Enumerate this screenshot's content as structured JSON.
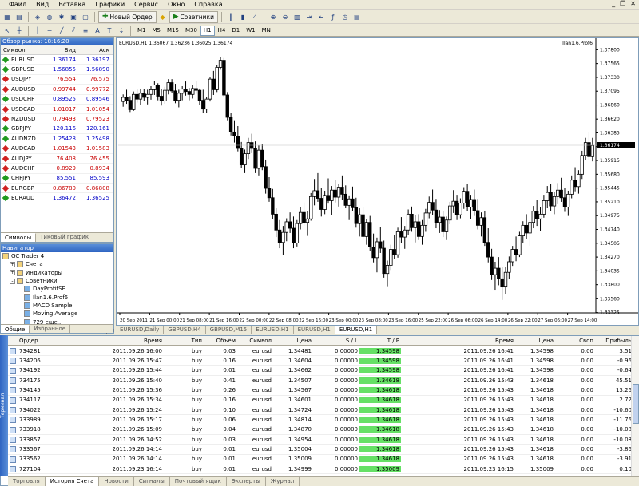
{
  "menu": [
    "Файл",
    "Вид",
    "Вставка",
    "Графики",
    "Сервис",
    "Окно",
    "Справка"
  ],
  "toolbar": {
    "new_order": "Новый Ордер",
    "advisors": "Советники",
    "timeframes": [
      "M1",
      "M5",
      "M15",
      "M30",
      "H1",
      "H4",
      "D1",
      "W1",
      "MN"
    ],
    "active_tf": "H1"
  },
  "market_watch": {
    "title": "Обзор рынка: 18:16:20",
    "col_symbol": "Символ",
    "col_bid": "Вид",
    "col_ask": "Аск",
    "rows": [
      {
        "s": "EURUSD",
        "b": "1.36174",
        "a": "1.36197",
        "d": "up"
      },
      {
        "s": "GBPUSD",
        "b": "1.56855",
        "a": "1.56890",
        "d": "up"
      },
      {
        "s": "USDJPY",
        "b": "76.554",
        "a": "76.575",
        "d": "dn"
      },
      {
        "s": "AUDUSD",
        "b": "0.99744",
        "a": "0.99772",
        "d": "dn"
      },
      {
        "s": "USDCHF",
        "b": "0.89525",
        "a": "0.89546",
        "d": "up"
      },
      {
        "s": "USDCAD",
        "b": "1.01017",
        "a": "1.01054",
        "d": "dn"
      },
      {
        "s": "NZDUSD",
        "b": "0.79493",
        "a": "0.79523",
        "d": "dn"
      },
      {
        "s": "GBPJPY",
        "b": "120.116",
        "a": "120.161",
        "d": "up"
      },
      {
        "s": "AUDNZD",
        "b": "1.25428",
        "a": "1.25498",
        "d": "up"
      },
      {
        "s": "AUDCAD",
        "b": "1.01543",
        "a": "1.01583",
        "d": "dn"
      },
      {
        "s": "AUDJPY",
        "b": "76.408",
        "a": "76.455",
        "d": "dn"
      },
      {
        "s": "AUDCHF",
        "b": "0.8929",
        "a": "0.8934",
        "d": "dn"
      },
      {
        "s": "CHFJPY",
        "b": "85.551",
        "a": "85.593",
        "d": "up"
      },
      {
        "s": "EURGBP",
        "b": "0.86780",
        "a": "0.86808",
        "d": "dn"
      },
      {
        "s": "EURAUD",
        "b": "1.36472",
        "a": "1.36525",
        "d": "up"
      }
    ],
    "tabs": [
      "Символы",
      "Тиковый график"
    ]
  },
  "navigator": {
    "title": "Навигатор",
    "items": [
      {
        "t": "GC Trader 4",
        "lvl": 0,
        "pm": ""
      },
      {
        "t": "Счета",
        "lvl": 1,
        "pm": "+"
      },
      {
        "t": "Индикаторы",
        "lvl": 1,
        "pm": "+"
      },
      {
        "t": "Советники",
        "lvl": 1,
        "pm": "-"
      },
      {
        "t": "DayProfitSE",
        "lvl": 2,
        "pm": ""
      },
      {
        "t": "Ilan1.6.Prof6",
        "lvl": 2,
        "pm": ""
      },
      {
        "t": "MACD Sample",
        "lvl": 2,
        "pm": ""
      },
      {
        "t": "Moving Average",
        "lvl": 2,
        "pm": ""
      },
      {
        "t": "729 еще...",
        "lvl": 2,
        "pm": ""
      },
      {
        "t": "Пользовательские Индикаторы",
        "lvl": 1,
        "pm": "+"
      }
    ],
    "tabs": [
      "Общие",
      "Избранное"
    ]
  },
  "chart": {
    "header": "EURUSD,H1  1.36067 1.36236 1.36025 1.36174",
    "ea_label": "Ilan1.6.Prof6",
    "current_price": "1.36174",
    "price_labels": [
      "1.37800",
      "1.37565",
      "1.37330",
      "1.37095",
      "1.36860",
      "1.36620",
      "1.36385",
      "1.36150",
      "1.35915",
      "1.35680",
      "1.35445",
      "1.35210",
      "1.34975",
      "1.34740",
      "1.34505",
      "1.34270",
      "1.34035",
      "1.33800",
      "1.33560",
      "1.33325"
    ],
    "time_labels": [
      "20 Sep 2011",
      "21 Sep 00:00",
      "21 Sep 08:00",
      "21 Sep 16:00",
      "22 Sep 00:00",
      "22 Sep 08:00",
      "22 Sep 16:00",
      "23 Sep 00:00",
      "23 Sep 08:00",
      "23 Sep 16:00",
      "25 Sep 22:00",
      "26 Sep 06:00",
      "26 Sep 14:00",
      "26 Sep 22:00",
      "27 Sep 06:00",
      "27 Sep 14:00"
    ]
  },
  "chart_data": {
    "type": "candlestick",
    "symbol": "EURUSD",
    "timeframe": "H1",
    "ylim": [
      1.3332,
      1.379
    ],
    "current": 1.36174,
    "candles": [
      [
        1.3692,
        1.3704,
        1.3683,
        1.3699
      ],
      [
        1.3699,
        1.3712,
        1.3688,
        1.3694
      ],
      [
        1.3694,
        1.3701,
        1.3674,
        1.3678
      ],
      [
        1.3678,
        1.3709,
        1.3676,
        1.3704
      ],
      [
        1.3704,
        1.3713,
        1.369,
        1.3696
      ],
      [
        1.3696,
        1.3713,
        1.3686,
        1.3706
      ],
      [
        1.3706,
        1.3713,
        1.3693,
        1.3699
      ],
      [
        1.3699,
        1.3712,
        1.3687,
        1.3704
      ],
      [
        1.3704,
        1.3718,
        1.3695,
        1.3712
      ],
      [
        1.3712,
        1.3727,
        1.3703,
        1.372
      ],
      [
        1.372,
        1.3723,
        1.3694,
        1.3701
      ],
      [
        1.3701,
        1.3713,
        1.3685,
        1.3693
      ],
      [
        1.3693,
        1.3717,
        1.3688,
        1.3711
      ],
      [
        1.3711,
        1.373,
        1.3704,
        1.3724
      ],
      [
        1.3724,
        1.373,
        1.3707,
        1.371
      ],
      [
        1.371,
        1.3722,
        1.3689,
        1.3694
      ],
      [
        1.3694,
        1.3712,
        1.3682,
        1.3706
      ],
      [
        1.3706,
        1.3718,
        1.3694,
        1.3713
      ],
      [
        1.3713,
        1.3726,
        1.3702,
        1.3709
      ],
      [
        1.3709,
        1.3715,
        1.3694,
        1.3704
      ],
      [
        1.3704,
        1.372,
        1.3697,
        1.3714
      ],
      [
        1.3714,
        1.3727,
        1.3705,
        1.3711
      ],
      [
        1.3711,
        1.3714,
        1.3686,
        1.3694
      ],
      [
        1.3694,
        1.3712,
        1.3673,
        1.3679
      ],
      [
        1.3679,
        1.37,
        1.3672,
        1.3696
      ],
      [
        1.3696,
        1.3734,
        1.3692,
        1.373
      ],
      [
        1.373,
        1.3744,
        1.3703,
        1.3712
      ],
      [
        1.3712,
        1.3754,
        1.3708,
        1.375
      ],
      [
        1.375,
        1.3768,
        1.3746,
        1.3762
      ],
      [
        1.3762,
        1.3766,
        1.37,
        1.3703
      ],
      [
        1.3703,
        1.3708,
        1.366,
        1.3665
      ],
      [
        1.3665,
        1.3672,
        1.3634,
        1.364
      ],
      [
        1.364,
        1.366,
        1.3622,
        1.3633
      ],
      [
        1.3633,
        1.365,
        1.3607,
        1.3612
      ],
      [
        1.3612,
        1.3623,
        1.3578,
        1.3584
      ],
      [
        1.3584,
        1.361,
        1.357,
        1.3603
      ],
      [
        1.3603,
        1.363,
        1.3594,
        1.3622
      ],
      [
        1.3622,
        1.3637,
        1.3604,
        1.3612
      ],
      [
        1.3612,
        1.3624,
        1.357,
        1.3578
      ],
      [
        1.3578,
        1.3617,
        1.3566,
        1.3609
      ],
      [
        1.3609,
        1.362,
        1.3575,
        1.3581
      ],
      [
        1.3581,
        1.3593,
        1.3535,
        1.3544
      ],
      [
        1.3544,
        1.3563,
        1.3521,
        1.3528
      ],
      [
        1.3528,
        1.3543,
        1.3492,
        1.35
      ],
      [
        1.35,
        1.351,
        1.3461,
        1.3473
      ],
      [
        1.3473,
        1.349,
        1.3442,
        1.3452
      ],
      [
        1.3452,
        1.348,
        1.343,
        1.3469
      ],
      [
        1.3469,
        1.3493,
        1.3454,
        1.3487
      ],
      [
        1.3487,
        1.3503,
        1.3468,
        1.3476
      ],
      [
        1.3476,
        1.3496,
        1.3442,
        1.3451
      ],
      [
        1.3451,
        1.349,
        1.3445,
        1.3484
      ],
      [
        1.3484,
        1.3512,
        1.3474,
        1.3503
      ],
      [
        1.3503,
        1.352,
        1.348,
        1.3486
      ],
      [
        1.3486,
        1.3505,
        1.3463,
        1.3492
      ],
      [
        1.3492,
        1.3536,
        1.3489,
        1.353
      ],
      [
        1.353,
        1.356,
        1.3515,
        1.354
      ],
      [
        1.354,
        1.357,
        1.3521,
        1.3527
      ],
      [
        1.3527,
        1.3544,
        1.3496,
        1.3508
      ],
      [
        1.3508,
        1.354,
        1.35,
        1.3532
      ],
      [
        1.3532,
        1.3561,
        1.3518,
        1.3523
      ],
      [
        1.3523,
        1.3548,
        1.3499,
        1.3541
      ],
      [
        1.3541,
        1.3558,
        1.352,
        1.3529
      ],
      [
        1.3529,
        1.3551,
        1.3513,
        1.3546
      ],
      [
        1.3546,
        1.3566,
        1.3525,
        1.3534
      ],
      [
        1.3534,
        1.3549,
        1.351,
        1.3515
      ],
      [
        1.3515,
        1.3532,
        1.349,
        1.3526
      ],
      [
        1.3526,
        1.3547,
        1.3506,
        1.3511
      ],
      [
        1.3511,
        1.3528,
        1.3477,
        1.3484
      ],
      [
        1.3484,
        1.351,
        1.3462,
        1.3499
      ],
      [
        1.3499,
        1.3512,
        1.3456,
        1.3462
      ],
      [
        1.3462,
        1.3491,
        1.3448,
        1.3486
      ],
      [
        1.3486,
        1.3497,
        1.3437,
        1.3444
      ],
      [
        1.3444,
        1.3467,
        1.3418,
        1.3426
      ],
      [
        1.3426,
        1.346,
        1.3401,
        1.3453
      ],
      [
        1.3453,
        1.3478,
        1.3434,
        1.3442
      ],
      [
        1.3442,
        1.3455,
        1.3392,
        1.3399
      ],
      [
        1.3399,
        1.3421,
        1.3376,
        1.3413
      ],
      [
        1.3413,
        1.3448,
        1.3405,
        1.344
      ],
      [
        1.344,
        1.3465,
        1.3424,
        1.3431
      ],
      [
        1.3431,
        1.3477,
        1.3426,
        1.347
      ],
      [
        1.347,
        1.3495,
        1.3451,
        1.3461
      ],
      [
        1.3461,
        1.348,
        1.3441,
        1.3473
      ],
      [
        1.3473,
        1.3508,
        1.3464,
        1.35
      ],
      [
        1.35,
        1.3513,
        1.347,
        1.3477
      ],
      [
        1.3477,
        1.3499,
        1.3452,
        1.3487
      ],
      [
        1.3487,
        1.35,
        1.3456,
        1.3462
      ],
      [
        1.3462,
        1.349,
        1.3448,
        1.3481
      ],
      [
        1.3481,
        1.3509,
        1.347,
        1.3502
      ],
      [
        1.3502,
        1.353,
        1.3493,
        1.352
      ],
      [
        1.352,
        1.3542,
        1.3498,
        1.3507
      ],
      [
        1.3507,
        1.3526,
        1.3476,
        1.3486
      ],
      [
        1.3486,
        1.3507,
        1.3468,
        1.3495
      ],
      [
        1.3495,
        1.3505,
        1.3461,
        1.347
      ],
      [
        1.347,
        1.3496,
        1.3456,
        1.349
      ],
      [
        1.349,
        1.3521,
        1.3483,
        1.3514
      ],
      [
        1.3514,
        1.3541,
        1.3502,
        1.3522
      ],
      [
        1.3522,
        1.3533,
        1.349,
        1.3499
      ],
      [
        1.3499,
        1.3527,
        1.3493,
        1.3519
      ],
      [
        1.3519,
        1.3546,
        1.3509,
        1.3539
      ],
      [
        1.3539,
        1.3552,
        1.3505,
        1.3512
      ],
      [
        1.3512,
        1.3533,
        1.3491,
        1.3525
      ],
      [
        1.3525,
        1.3542,
        1.3497,
        1.3506
      ],
      [
        1.3506,
        1.3526,
        1.3474,
        1.3481
      ],
      [
        1.3481,
        1.3503,
        1.3462,
        1.3494
      ],
      [
        1.3494,
        1.3506,
        1.3446,
        1.3452
      ],
      [
        1.3452,
        1.3476,
        1.3418,
        1.3427
      ],
      [
        1.3427,
        1.3441,
        1.3388,
        1.3397
      ],
      [
        1.3397,
        1.3419,
        1.337,
        1.3408
      ],
      [
        1.3408,
        1.3427,
        1.3379,
        1.339
      ],
      [
        1.339,
        1.341,
        1.3354,
        1.3376
      ],
      [
        1.3376,
        1.341,
        1.3364,
        1.3401
      ],
      [
        1.3401,
        1.3428,
        1.339,
        1.3419
      ],
      [
        1.3419,
        1.3446,
        1.3412,
        1.344
      ],
      [
        1.344,
        1.3462,
        1.342,
        1.3431
      ],
      [
        1.3431,
        1.347,
        1.3427,
        1.3463
      ],
      [
        1.3463,
        1.3488,
        1.3451,
        1.3481
      ],
      [
        1.3481,
        1.35,
        1.3458,
        1.3468
      ],
      [
        1.3468,
        1.349,
        1.3446,
        1.3486
      ],
      [
        1.3486,
        1.3514,
        1.3476,
        1.3505
      ],
      [
        1.3505,
        1.3525,
        1.348,
        1.3492
      ],
      [
        1.3492,
        1.3512,
        1.3472,
        1.35
      ],
      [
        1.35,
        1.3533,
        1.3494,
        1.3523
      ],
      [
        1.3523,
        1.3548,
        1.351,
        1.3537
      ],
      [
        1.3537,
        1.3551,
        1.3505,
        1.3514
      ],
      [
        1.3514,
        1.3538,
        1.35,
        1.353
      ],
      [
        1.353,
        1.3553,
        1.3517,
        1.3541
      ],
      [
        1.3541,
        1.3562,
        1.3521,
        1.3528
      ],
      [
        1.3528,
        1.3545,
        1.3504,
        1.3512
      ],
      [
        1.3512,
        1.354,
        1.3497,
        1.3534
      ],
      [
        1.3534,
        1.3566,
        1.3527,
        1.3558
      ],
      [
        1.3558,
        1.358,
        1.3539,
        1.3547
      ],
      [
        1.3547,
        1.3575,
        1.3535,
        1.3568
      ],
      [
        1.3568,
        1.3608,
        1.356,
        1.36
      ],
      [
        1.36,
        1.363,
        1.3592,
        1.3622
      ],
      [
        1.3622,
        1.364,
        1.3592,
        1.3598
      ],
      [
        1.3598,
        1.363,
        1.359,
        1.3617
      ]
    ]
  },
  "chart_tabs": [
    "EURUSD,Daily",
    "GBPUSD,H4",
    "GBPUSD,M15",
    "EURUSD,H1",
    "EURUSD,H1",
    "EURUSD,H1"
  ],
  "terminal": {
    "title": "Терминал",
    "columns": [
      "Ордер",
      "Время",
      "Тип",
      "Объём",
      "Символ",
      "Цена",
      "S / L",
      "T / P",
      "Время",
      "Цена",
      "Своп",
      "Прибыль"
    ],
    "rows": [
      [
        "734281",
        "2011.09.26 16:00",
        "buy",
        "0.03",
        "eurusd",
        "1.34481",
        "0.00000",
        "1.34598",
        "2011.09.26 16:41",
        "1.34598",
        "0.00",
        "3.51"
      ],
      [
        "734206",
        "2011.09.26 15:47",
        "buy",
        "0.16",
        "eurusd",
        "1.34604",
        "0.00000",
        "1.34598",
        "2011.09.26 16:41",
        "1.34598",
        "0.00",
        "-0.96"
      ],
      [
        "734192",
        "2011.09.26 15:44",
        "buy",
        "0.01",
        "eurusd",
        "1.34662",
        "0.00000",
        "1.34598",
        "2011.09.26 16:41",
        "1.34598",
        "0.00",
        "-0.64"
      ],
      [
        "734175",
        "2011.09.26 15:40",
        "buy",
        "0.41",
        "eurusd",
        "1.34507",
        "0.00000",
        "1.34618",
        "2011.09.26 15:43",
        "1.34618",
        "0.00",
        "45.51"
      ],
      [
        "734145",
        "2011.09.26 15:36",
        "buy",
        "0.26",
        "eurusd",
        "1.34567",
        "0.00000",
        "1.34618",
        "2011.09.26 15:43",
        "1.34618",
        "0.00",
        "13.26"
      ],
      [
        "734117",
        "2011.09.26 15:34",
        "buy",
        "0.16",
        "eurusd",
        "1.34601",
        "0.00000",
        "1.34618",
        "2011.09.26 15:43",
        "1.34618",
        "0.00",
        "2.72"
      ],
      [
        "734022",
        "2011.09.26 15:24",
        "buy",
        "0.10",
        "eurusd",
        "1.34724",
        "0.00000",
        "1.34618",
        "2011.09.26 15:43",
        "1.34618",
        "0.00",
        "-10.60"
      ],
      [
        "733989",
        "2011.09.26 15:17",
        "buy",
        "0.06",
        "eurusd",
        "1.34814",
        "0.00000",
        "1.34618",
        "2011.09.26 15:43",
        "1.34618",
        "0.00",
        "-11.76"
      ],
      [
        "733918",
        "2011.09.26 15:09",
        "buy",
        "0.04",
        "eurusd",
        "1.34870",
        "0.00000",
        "1.34618",
        "2011.09.26 15:43",
        "1.34618",
        "0.00",
        "-10.08"
      ],
      [
        "733857",
        "2011.09.26 14:52",
        "buy",
        "0.03",
        "eurusd",
        "1.34954",
        "0.00000",
        "1.34618",
        "2011.09.26 15:43",
        "1.34618",
        "0.00",
        "-10.08"
      ],
      [
        "733567",
        "2011.09.26 14:14",
        "buy",
        "0.01",
        "eurusd",
        "1.35004",
        "0.00000",
        "1.34618",
        "2011.09.26 15:43",
        "1.34618",
        "0.00",
        "-3.86"
      ],
      [
        "733562",
        "2011.09.26 14:14",
        "buy",
        "0.01",
        "eurusd",
        "1.35009",
        "0.00000",
        "1.34618",
        "2011.09.26 15:43",
        "1.34618",
        "0.00",
        "-3.91"
      ],
      [
        "727104",
        "2011.09.23 16:14",
        "buy",
        "0.01",
        "eurusd",
        "1.34999",
        "0.00000",
        "1.35009",
        "2011.09.23 16:15",
        "1.35009",
        "0.00",
        "0.10"
      ]
    ],
    "tabs": [
      "Торговля",
      "История Счета",
      "Новости",
      "Сигналы",
      "Почтовый ящик",
      "Эксперты",
      "Журнал"
    ]
  }
}
